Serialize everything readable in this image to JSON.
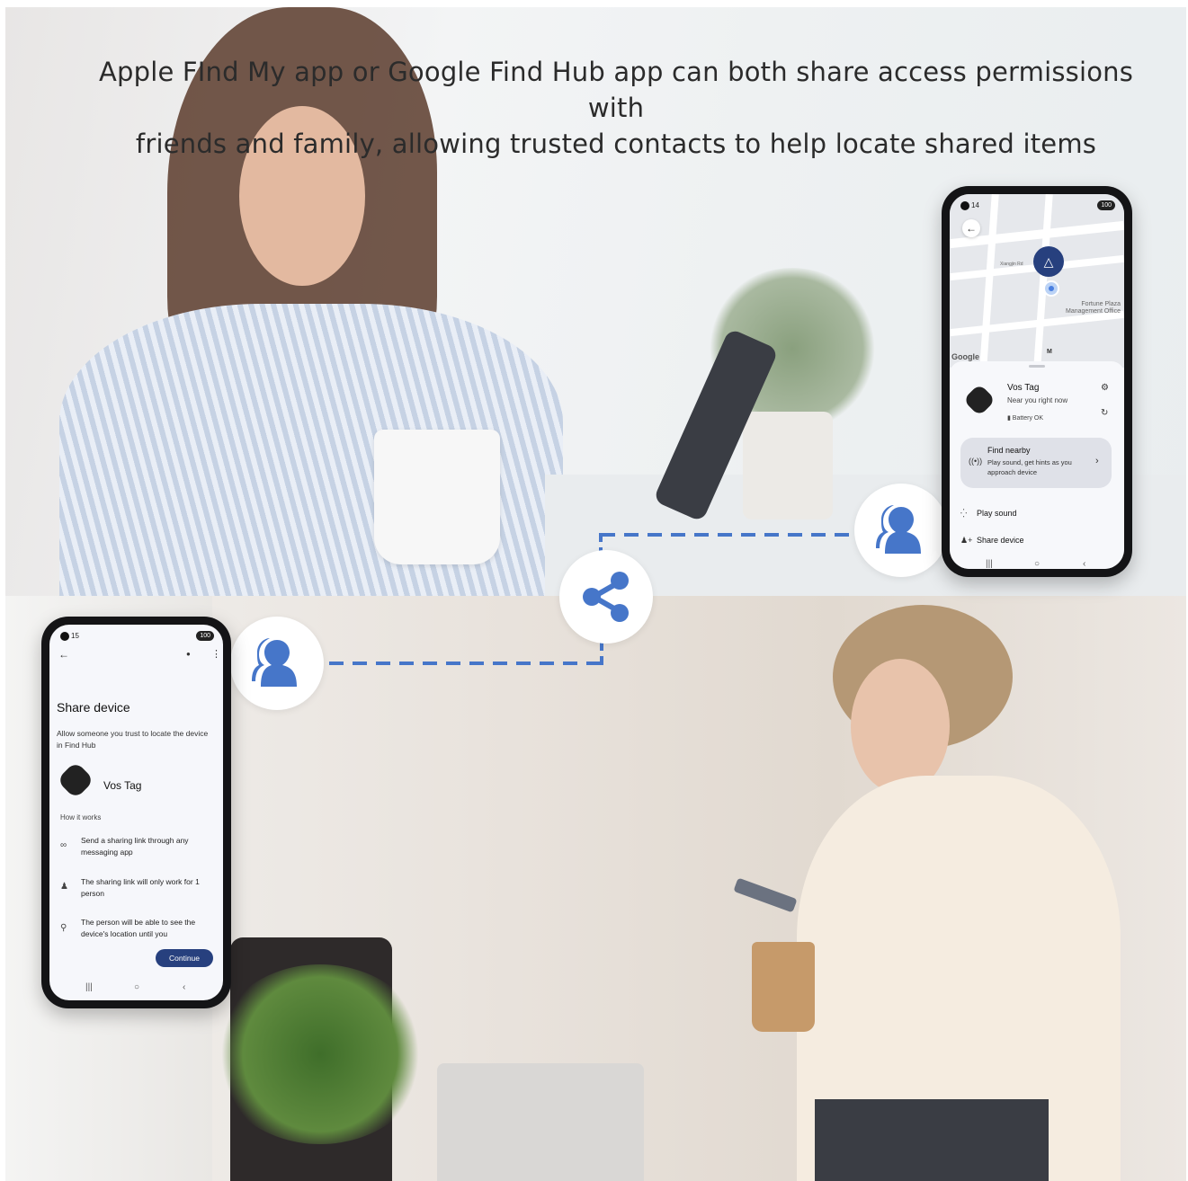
{
  "headline": {
    "line1": "Apple FInd My app or Google Find Hub app can both share access permissions with",
    "line2": "friends and family, allowing trusted contacts to help locate shared items"
  },
  "top_phone": {
    "status_time": "14",
    "battery": "100",
    "map": {
      "street_label": "Xiangjin Rd",
      "poi_label_line1": "Fortune Plaza",
      "poi_label_line2": "Management Office",
      "metro_label": "M",
      "google_label": "Google"
    },
    "device_name": "Vos Tag",
    "device_status": "Near you right now",
    "battery_status": "Battery OK",
    "find_nearby": {
      "title": "Find nearby",
      "description": "Play sound, get hints as you approach device"
    },
    "play_sound": "Play sound",
    "share_device": "Share device"
  },
  "bottom_phone": {
    "status_time": "15",
    "battery": "100",
    "title": "Share device",
    "description": "Allow someone you trust to locate the device in Find Hub",
    "device_name": "Vos Tag",
    "how_it_works": "How it works",
    "steps": [
      "Send a sharing link through any messaging app",
      "The sharing link will only work for 1 person",
      "The person will be able to see the device's location until you"
    ],
    "continue_label": "Continue"
  },
  "icons": {
    "person": "person-icon",
    "share": "share-icon"
  },
  "colors": {
    "accent": "#4676c9",
    "button": "#27407e"
  }
}
